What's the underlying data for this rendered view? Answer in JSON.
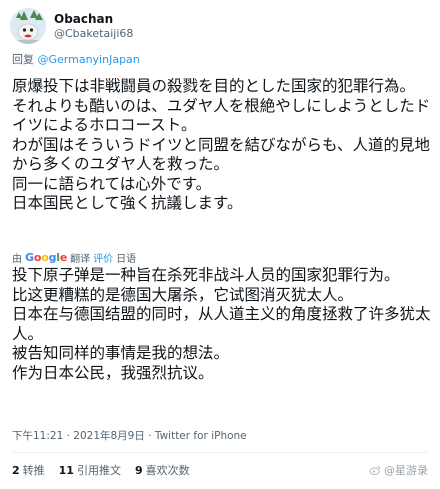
{
  "author": {
    "display_name": "Obachan",
    "handle": "@Cbaketaiji68"
  },
  "reply": {
    "prefix": "回复 ",
    "mention": "@GermanyinJapan"
  },
  "tweet_ja": [
    "原爆投下は非戦闘員の殺戮を目的とした国家的犯罪行為。",
    "それよりも酷いのは、ユダヤ人を根絶やしにしようとしたドイツによるホロコースト。",
    "わが国はそういうドイツと同盟を結びながらも、人道的見地から多くのユダヤ人を救った。",
    "同一に語られては心外です。",
    "日本国民として強く抗議します。"
  ],
  "translation": {
    "by": "由",
    "brand_b": "G",
    "brand_r": "o",
    "brand_y": "o",
    "brand_b2": "g",
    "brand_g": "l",
    "brand_r2": "e",
    "action": "翻译",
    "rate": "评价",
    "language": "日语"
  },
  "tweet_zh": [
    "投下原子弹是一种旨在杀死非战斗人员的国家犯罪行为。",
    "比这更糟糕的是德国大屠杀，它试图消灭犹太人。",
    "日本在与德国结盟的同时，从人道主义的角度拯救了许多犹太人。",
    "被告知同样的事情是我的想法。",
    "作为日本公民，我强烈抗议。"
  ],
  "meta": {
    "time": "下午11:21",
    "sep": " · ",
    "date": "2021年8月9日",
    "sep2": " · ",
    "source": "Twitter for iPhone"
  },
  "stats": {
    "retweets_count": "2",
    "retweets_label": "转推",
    "quotes_count": "11",
    "quotes_label": "引用推文",
    "likes_count": "9",
    "likes_label": "喜欢次数"
  },
  "watermark": {
    "text": "@星游录"
  },
  "colors": {
    "link": "#1d9bf0",
    "muted": "#536471",
    "text": "#0f1419"
  }
}
